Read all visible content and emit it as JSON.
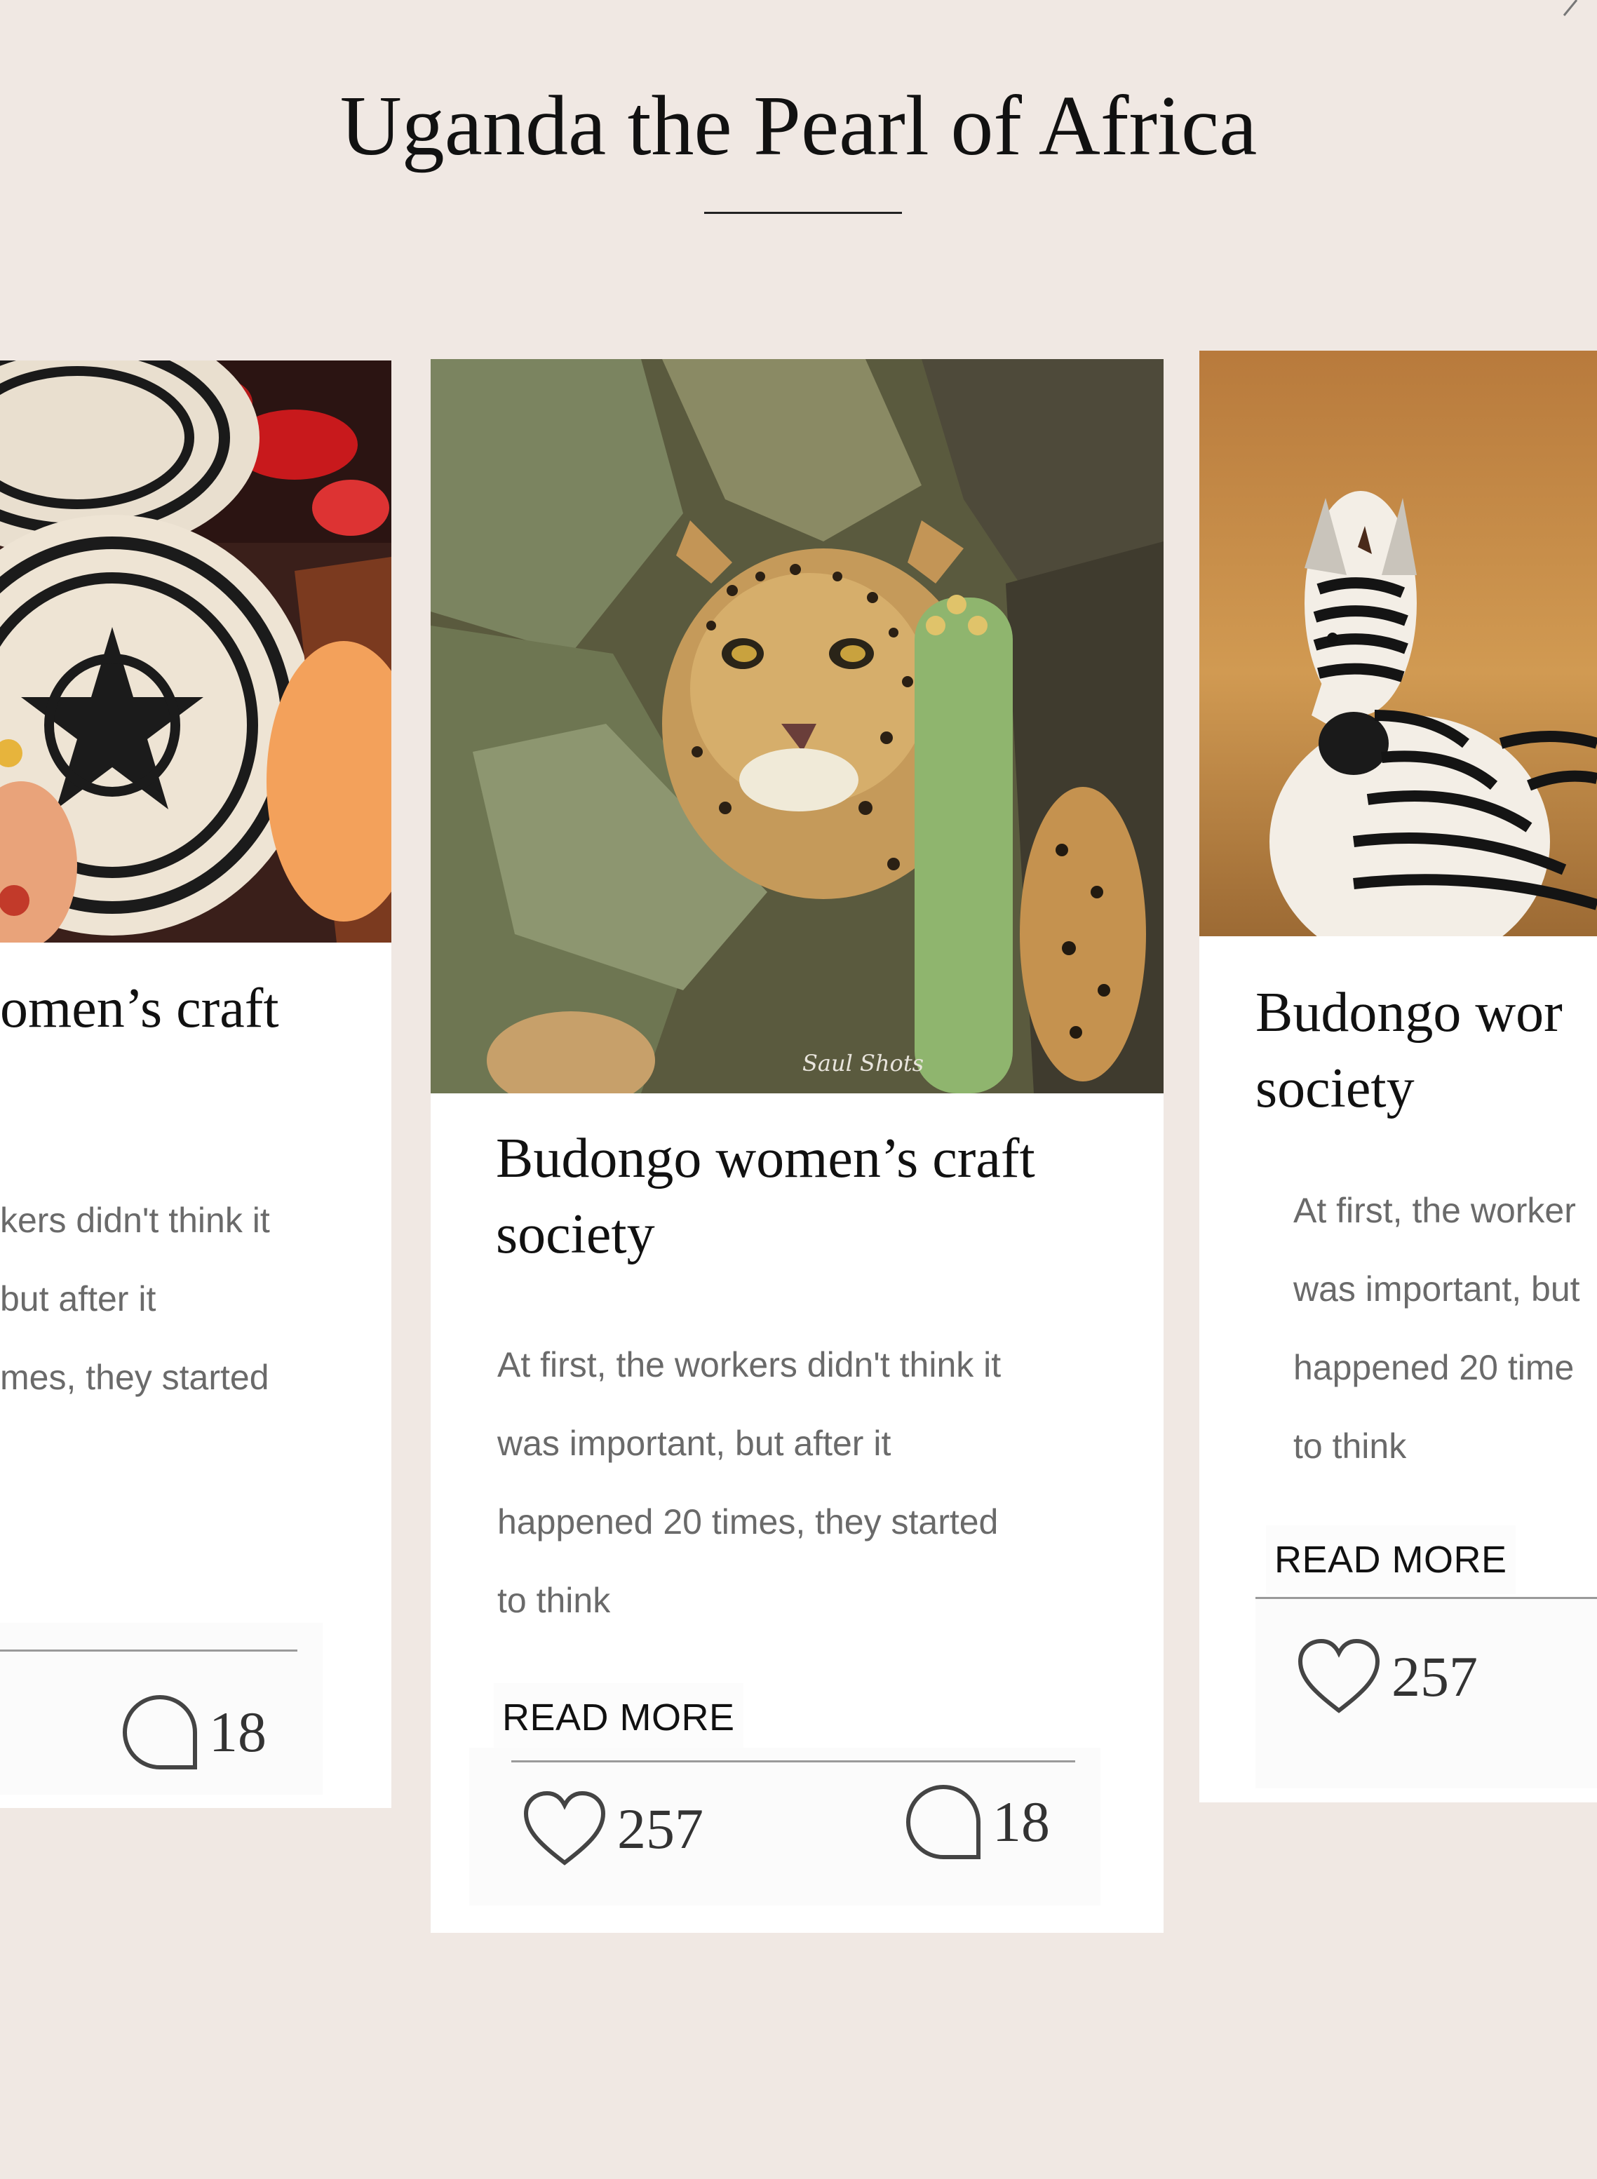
{
  "section": {
    "title": "Uganda the Pearl of Africa"
  },
  "cards": [
    {
      "title": "omen’s craft",
      "excerpt": "kers didn't think it\nbut after it\nmes, they started",
      "comments": "18"
    },
    {
      "title": "Budongo women’s craft\nsociety",
      "excerpt": "At first, the workers didn't think it\nwas important, but after it\nhappened 20 times, they started\nto think",
      "read_more": "READ MORE",
      "likes": "257",
      "comments": "18",
      "image_caption": "Saul Shots"
    },
    {
      "title": "Budongo wor\nsociety",
      "excerpt": "At first, the worker\nwas important, but\nhappened 20 time\nto think",
      "read_more": "READ MORE",
      "likes": "257"
    }
  ],
  "icons": {
    "like": "heart-icon",
    "comment": "comment-bubble-icon",
    "next": "chevron-right-icon"
  },
  "colors": {
    "page_background": "#f0e8e3",
    "card_background": "#ffffff",
    "text_primary": "#111111",
    "text_muted": "#6a6a6a"
  }
}
